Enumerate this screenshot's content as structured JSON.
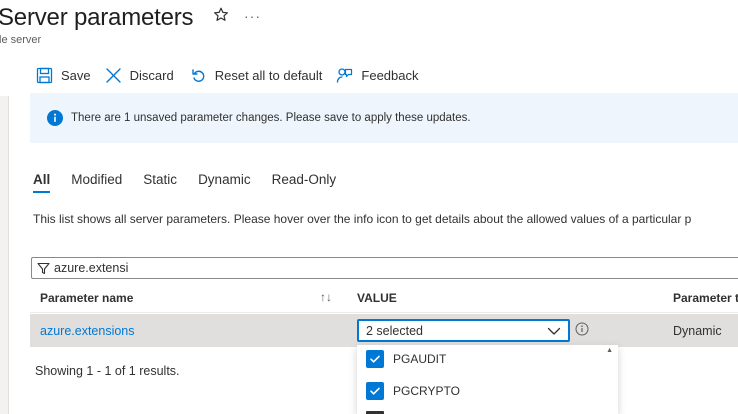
{
  "header": {
    "title": "Server parameters",
    "subtitle": "le server"
  },
  "toolbar": {
    "save_label": "Save",
    "discard_label": "Discard",
    "reset_label": "Reset all to default",
    "feedback_label": "Feedback"
  },
  "banner": {
    "message": "There are 1 unsaved parameter changes.  Please save to apply these updates."
  },
  "tabs": [
    {
      "label": "All",
      "active": true
    },
    {
      "label": "Modified",
      "active": false
    },
    {
      "label": "Static",
      "active": false
    },
    {
      "label": "Dynamic",
      "active": false
    },
    {
      "label": "Read-Only",
      "active": false
    }
  ],
  "description": "This list shows all server parameters. Please hover over the info icon to get details about the allowed values of a particular p",
  "filter": {
    "value": "azure.extensi"
  },
  "table": {
    "columns": {
      "name": "Parameter name",
      "value": "VALUE",
      "type": "Parameter t"
    },
    "rows": [
      {
        "name": "azure.extensions",
        "value": "2 selected",
        "type": "Dynamic"
      }
    ]
  },
  "results_text": "Showing 1 - 1 of 1 results.",
  "dropdown": {
    "options": [
      {
        "label": "PGAUDIT",
        "checked": true
      },
      {
        "label": "PGCRYPTO",
        "checked": true
      }
    ]
  },
  "colors": {
    "accent": "#0078d4",
    "banner_bg": "#eef5fc",
    "row_selected": "#e1dfdd"
  }
}
